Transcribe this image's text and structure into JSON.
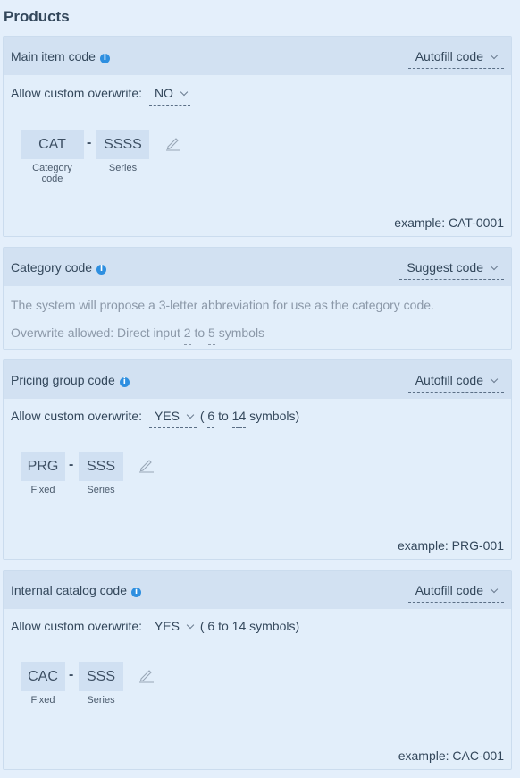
{
  "page": {
    "title": "Products"
  },
  "cards": {
    "main": {
      "title": "Main item code",
      "mode": "Autofill code",
      "overwrite_label": "Allow custom overwrite:",
      "overwrite_value": "NO",
      "segments": [
        {
          "value": "CAT",
          "caption": "Category code"
        },
        {
          "value": "SSSS",
          "caption": "Series"
        }
      ],
      "separator": "-",
      "example": "example: CAT-0001"
    },
    "category": {
      "title": "Category code",
      "mode": "Suggest code",
      "description": "The system will propose a 3-letter abbreviation for use as the category code.",
      "overwrite_prefix": "Overwrite allowed: Direct input",
      "min": "2",
      "to": "to",
      "max": "5",
      "suffix": "symbols"
    },
    "pricing": {
      "title": "Pricing group code",
      "mode": "Autofill code",
      "overwrite_label": "Allow custom overwrite:",
      "overwrite_value": "YES",
      "range_open": "(",
      "min": "6",
      "to": "to",
      "max": "14",
      "range_close": "symbols)",
      "segments": [
        {
          "value": "PRG",
          "caption": "Fixed"
        },
        {
          "value": "SSS",
          "caption": "Series"
        }
      ],
      "separator": "-",
      "example": "example: PRG-001"
    },
    "internal": {
      "title": "Internal catalog code",
      "mode": "Autofill code",
      "overwrite_label": "Allow custom overwrite:",
      "overwrite_value": "YES",
      "range_open": "(",
      "min": "6",
      "to": "to",
      "max": "14",
      "range_close": "symbols)",
      "segments": [
        {
          "value": "CAC",
          "caption": "Fixed"
        },
        {
          "value": "SSS",
          "caption": "Series"
        }
      ],
      "separator": "-",
      "example": "example: CAC-001"
    }
  },
  "icons": {
    "info": "info-icon",
    "edit": "pencil-icon",
    "dropdown": "chevron-down-icon"
  },
  "colors": {
    "accent": "#2e8fe0",
    "header_bg": "#d2e1f2",
    "page_bg": "#e4effb"
  }
}
